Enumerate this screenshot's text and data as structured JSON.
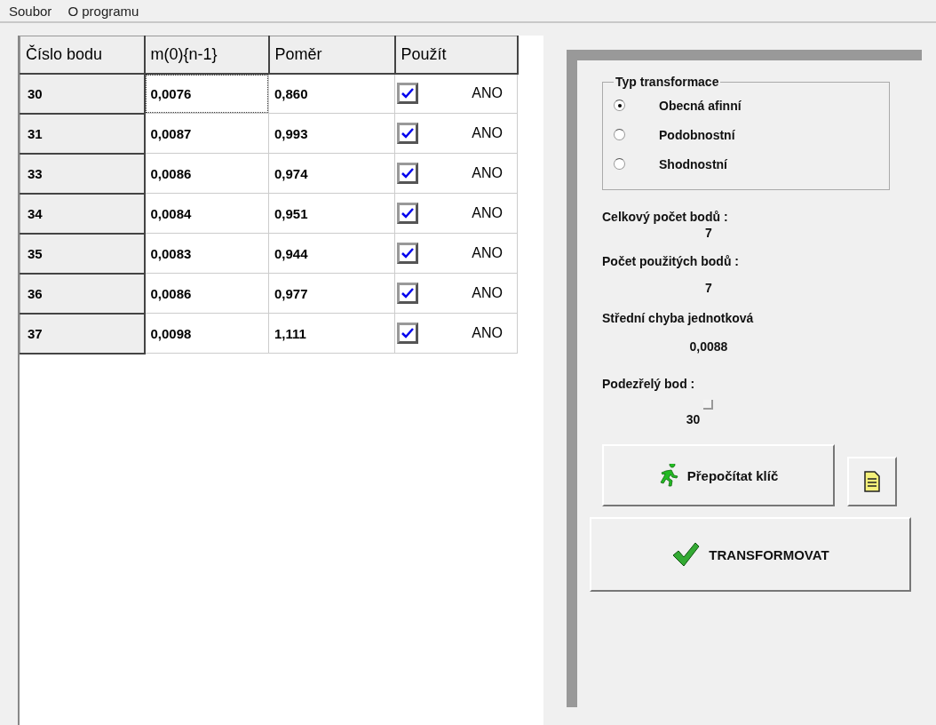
{
  "menu": [
    {
      "label": "Soubor"
    },
    {
      "label": "O programu"
    }
  ],
  "table": {
    "columns": [
      "Číslo bodu",
      "m(0){n-1}",
      "Poměr",
      "Použít"
    ],
    "rows": [
      {
        "point": "30",
        "m": "0,0076",
        "ratio": "0,860",
        "used": true,
        "used_label": "ANO",
        "selected": true
      },
      {
        "point": "31",
        "m": "0,0087",
        "ratio": "0,993",
        "used": true,
        "used_label": "ANO",
        "selected": false
      },
      {
        "point": "33",
        "m": "0,0086",
        "ratio": "0,974",
        "used": true,
        "used_label": "ANO",
        "selected": false
      },
      {
        "point": "34",
        "m": "0,0084",
        "ratio": "0,951",
        "used": true,
        "used_label": "ANO",
        "selected": false
      },
      {
        "point": "35",
        "m": "0,0083",
        "ratio": "0,944",
        "used": true,
        "used_label": "ANO",
        "selected": false
      },
      {
        "point": "36",
        "m": "0,0086",
        "ratio": "0,977",
        "used": true,
        "used_label": "ANO",
        "selected": false
      },
      {
        "point": "37",
        "m": "0,0098",
        "ratio": "1,111",
        "used": true,
        "used_label": "ANO",
        "selected": false
      }
    ]
  },
  "transform_type": {
    "title": "Typ transformace",
    "options": [
      {
        "label": "Obecná afinní",
        "selected": true
      },
      {
        "label": "Podobnostní",
        "selected": false
      },
      {
        "label": "Shodnostní",
        "selected": false
      }
    ]
  },
  "stats": [
    {
      "label": "Celkový počet bodů :",
      "value": "7"
    },
    {
      "label": "Počet použitých bodů :",
      "value": "7"
    },
    {
      "label": "Střední chyba jednotková",
      "value": "0,0088"
    }
  ],
  "suspect": {
    "label": "Podezřelý bod :",
    "value": "30"
  },
  "buttons": {
    "recalc": "Přepočítat klíč",
    "transform": "TRANSFORMOVAT"
  }
}
